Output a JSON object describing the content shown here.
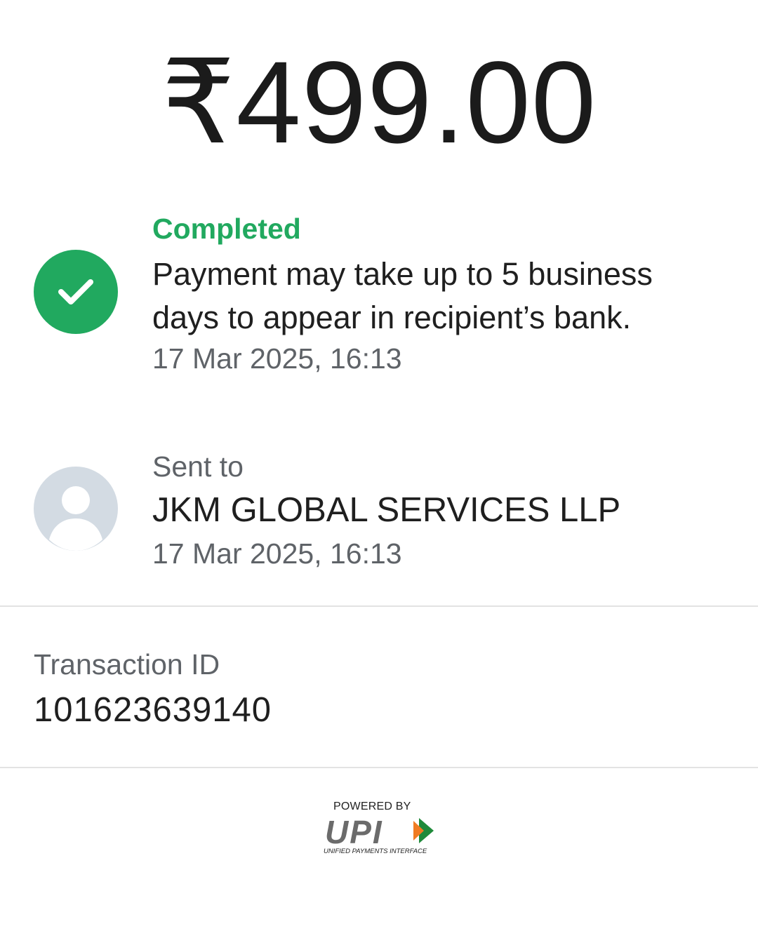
{
  "payment": {
    "amount": "₹499.00"
  },
  "status": {
    "label": "Completed",
    "message": "Payment may take up to 5 business days to appear in recipient’s bank.",
    "timestamp": "17 Mar 2025, 16:13",
    "icon": "check-circle-icon",
    "color": "#21a95f"
  },
  "recipient": {
    "label": "Sent to",
    "name": "JKM GLOBAL SERVICES LLP",
    "timestamp": "17 Mar 2025, 16:13",
    "avatar_icon": "person-icon"
  },
  "transaction": {
    "label": "Transaction ID",
    "id": "101623639140"
  },
  "branding": {
    "powered_by": "POWERED BY",
    "logo_text": "UPI",
    "tagline": "UNIFIED PAYMENTS INTERFACE"
  }
}
